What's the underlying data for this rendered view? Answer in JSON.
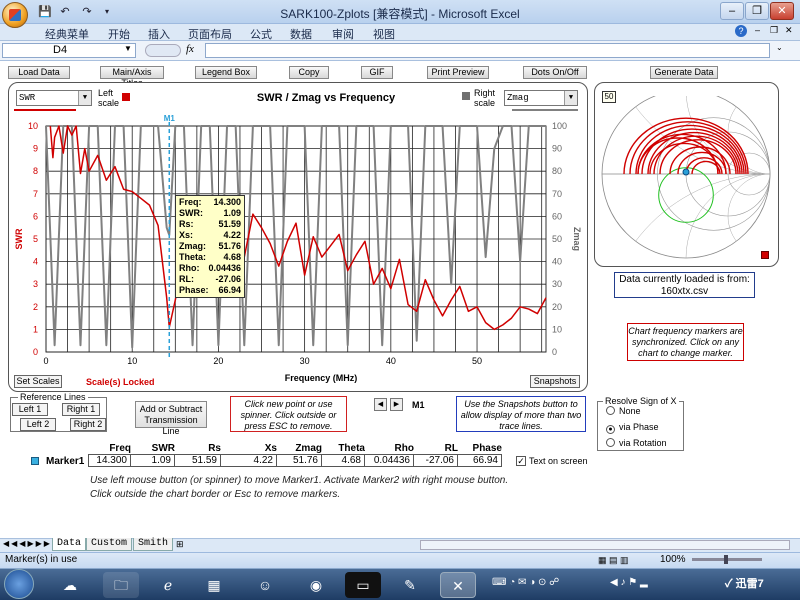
{
  "window": {
    "title": "SARK100-Zplots  [兼容模式] - Microsoft Excel",
    "minimize": "–",
    "restore": "❐",
    "close": "✕",
    "help": "?"
  },
  "menu": [
    "经典菜单",
    "开始",
    "插入",
    "页面布局",
    "公式",
    "数据",
    "审阅",
    "视图"
  ],
  "formula_bar": {
    "name_box": "D4",
    "fx": "fx",
    "value": ""
  },
  "toolbar": {
    "load_data": "Load Data",
    "main_axis_titles": "Main/Axis Titles",
    "legend_box": "Legend Box",
    "copy": "Copy",
    "gif": "GIF",
    "print_preview": "Print Preview",
    "dots_onoff": "Dots On/Off",
    "generate_data": "Generate Data"
  },
  "chart_controls": {
    "left_select": "SWR",
    "left_scale": "Left scale",
    "right_select": "Zmag",
    "right_scale": "Right scale",
    "set_scales": "Set Scales",
    "scales_locked": "Scale(s) Locked",
    "snapshots": "Snapshots",
    "smith_badge": "50"
  },
  "chart_data": {
    "type": "line",
    "title": "SWR / Zmag  vs  Frequency",
    "xlabel": "Frequency (MHz)",
    "ylabel": "SWR",
    "y2label": "Zmag",
    "xlim": [
      0,
      58
    ],
    "ylim": [
      0,
      10
    ],
    "y2lim": [
      0,
      100
    ],
    "xticks": [
      0,
      10,
      20,
      30,
      40,
      50
    ],
    "yticks": [
      0,
      1,
      2,
      3,
      4,
      5,
      6,
      7,
      8,
      9,
      10
    ],
    "y2ticks": [
      0,
      10,
      20,
      30,
      40,
      50,
      60,
      70,
      80,
      90,
      100
    ],
    "grid": true,
    "marker": {
      "label": "M1",
      "x": 14.3
    },
    "series": [
      {
        "name": "SWR",
        "color": "#d00000",
        "x": [
          0.5,
          0.8,
          1,
          1.5,
          2,
          2.5,
          3,
          3.5,
          4,
          4.5,
          5,
          6,
          7,
          8,
          9,
          10,
          11,
          12,
          13,
          14,
          14.3,
          15,
          16,
          17,
          18,
          19,
          20,
          21,
          22,
          23,
          24,
          25,
          26,
          27,
          28,
          29,
          30,
          31,
          32,
          33,
          34,
          35,
          36,
          37,
          38,
          39,
          40,
          41,
          42,
          43,
          44,
          45,
          46,
          47,
          48,
          49,
          50,
          51,
          52,
          53,
          54,
          55,
          56,
          57,
          58
        ],
        "values": [
          10,
          8.6,
          9.5,
          10,
          8.8,
          10,
          9.6,
          10,
          7.9,
          9.0,
          8.0,
          8.7,
          7.6,
          8.2,
          7.2,
          7.1,
          6.8,
          6.5,
          5.6,
          2.4,
          1.09,
          2.3,
          4.1,
          6.2,
          5.2,
          6.6,
          4.8,
          6.8,
          5.9,
          4.2,
          6.1,
          5.5,
          4.8,
          3.8,
          4.9,
          5.7,
          3.4,
          5.1,
          4.2,
          4.7,
          5.2,
          3.6,
          4.3,
          4.9,
          3.0,
          3.7,
          2.8,
          4.1,
          2.1,
          1.8,
          3.2,
          2.3,
          1.6,
          2.3,
          2.9,
          1.8,
          2.0,
          1.3,
          1.0,
          1.2,
          1.5,
          2.0,
          1.9,
          1.7,
          2.4
        ]
      },
      {
        "name": "Zmag",
        "color": "#808080",
        "x": [
          0,
          1,
          2,
          3,
          4,
          5,
          6,
          7,
          8,
          9,
          10,
          11,
          12,
          13,
          14,
          14.3,
          15,
          16,
          17,
          18,
          19,
          20,
          21,
          22,
          23,
          24,
          25,
          26,
          27,
          28,
          29,
          30,
          31,
          32,
          33,
          34,
          35,
          36,
          37,
          38,
          39,
          40,
          41,
          42,
          43,
          44,
          45,
          46,
          47,
          48,
          49,
          50,
          51,
          52,
          53,
          54,
          55,
          56,
          57,
          58
        ],
        "values": [
          100,
          3,
          100,
          100,
          3,
          100,
          100,
          3,
          100,
          100,
          2,
          100,
          100,
          100,
          55,
          51.76,
          100,
          100,
          3,
          100,
          100,
          3,
          100,
          100,
          3,
          100,
          100,
          100,
          3,
          100,
          100,
          100,
          3,
          100,
          100,
          100,
          3,
          100,
          100,
          100,
          3,
          100,
          100,
          100,
          5,
          100,
          100,
          100,
          30,
          100,
          100,
          100,
          42,
          90,
          100,
          100,
          40,
          100,
          100,
          100
        ]
      }
    ]
  },
  "marker_tooltip": [
    {
      "k": "Freq:",
      "v": "14.300"
    },
    {
      "k": "SWR:",
      "v": "1.09"
    },
    {
      "k": "Rs:",
      "v": "51.59"
    },
    {
      "k": "Xs:",
      "v": "4.22"
    },
    {
      "k": "Zmag:",
      "v": "51.76"
    },
    {
      "k": "Theta:",
      "v": "4.68"
    },
    {
      "k": "Rho:",
      "v": "0.04436"
    },
    {
      "k": "RL:",
      "v": "-27.06"
    },
    {
      "k": "Phase:",
      "v": "66.94"
    }
  ],
  "data_source": {
    "line1": "Data currently  loaded is from:",
    "line2": "160xtx.csv"
  },
  "sync_note": "Chart frequency markers are synchronized.  Click on any chart to change marker.",
  "reference_lines": {
    "title": "Reference Lines",
    "left1": "Left 1",
    "right1": "Right 1",
    "left2": "Left 2",
    "right2": "Right 2"
  },
  "add_subtract": "Add or Subtract Transmission Line",
  "click_note": "Click new point or use spinner.  Click outside or press ESC to remove.",
  "spinner": {
    "left": "◀",
    "right": "▶",
    "label": "M1"
  },
  "snapshots_note": "Use the Snapshots button to allow display of more than two trace lines.",
  "resolve": {
    "title": "Resolve Sign of X",
    "options": [
      "None",
      "via Phase",
      "via Rotation"
    ],
    "selected": "via Phase"
  },
  "marker_table": {
    "headers": [
      "Freq",
      "SWR",
      "Rs",
      "Xs",
      "Zmag",
      "Theta",
      "Rho",
      "RL",
      "Phase"
    ],
    "row_label": "Marker1",
    "values": [
      "14.300",
      "1.09",
      "51.59",
      "4.22",
      "51.76",
      "4.68",
      "0.04436",
      "-27.06",
      "66.94"
    ],
    "text_on_screen": "Text on screen"
  },
  "instructions": [
    "Use left mouse button (or spinner) to move Marker1.  Activate Marker2 with right mouse button.",
    "Click outside the chart border or Esc to remove markers."
  ],
  "sheet_tabs": [
    "Data",
    "Custom",
    "Smith"
  ],
  "status": {
    "left": "Marker(s) in use",
    "zoom": "100%"
  },
  "colors": {
    "swr": "#d00000",
    "zmag": "#808080",
    "marker": "#2aa0d8",
    "smith_arc": "#d00000",
    "smith_circle": "#20c020"
  }
}
